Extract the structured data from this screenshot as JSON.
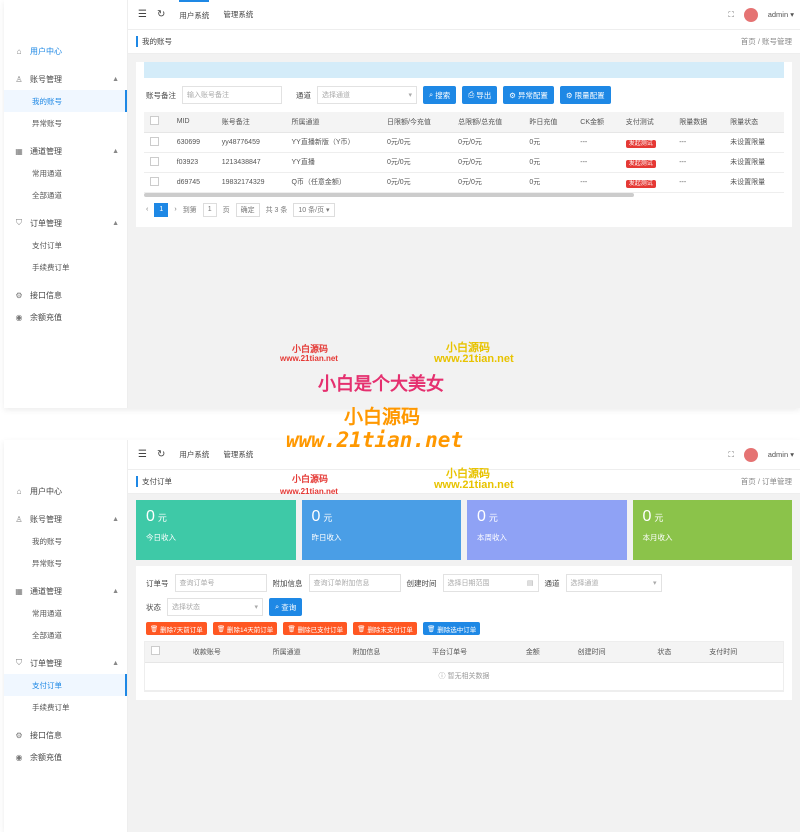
{
  "colors": {
    "accent": "#1e88e5",
    "stat1": "#3ec9a7",
    "stat2": "#4a9ee6",
    "stat3": "#8fa2f5",
    "stat4": "#8bc34a",
    "danger": "#ff5722"
  },
  "topbar": {
    "tabs": [
      "用户系统",
      "管理系统"
    ],
    "user": "admin"
  },
  "sidebar": {
    "home": "用户中心",
    "groups": [
      {
        "label": "账号管理",
        "items": [
          "我的账号",
          "异常账号"
        ]
      },
      {
        "label": "通道管理",
        "items": [
          "常用通道",
          "全部通道"
        ]
      },
      {
        "label": "订单管理",
        "items": [
          "支付订单",
          "手续费订单"
        ]
      }
    ],
    "api": "接口信息",
    "recharge": "余额充值"
  },
  "panel1": {
    "crumb_title": "我的账号",
    "crumb_path": "首页 / 账号管理",
    "filter": {
      "remark_label": "账号备注",
      "remark_placeholder": "输入账号备注",
      "channel_label": "通道",
      "channel_placeholder": "选择通道",
      "buttons": [
        "搜索",
        "导出",
        "异常配置",
        "限量配置"
      ]
    },
    "table": {
      "headers": [
        "MID",
        "账号备注",
        "所属通道",
        "日限额/今充值",
        "总限额/总充值",
        "昨日充值",
        "CK金额",
        "支付测试",
        "限量数据",
        "限量状态"
      ],
      "rows": [
        [
          "630699",
          "yy48776459",
          "YY直播新版（Y币）",
          "0元/0元",
          "0元/0元",
          "0元",
          "---",
          "发起测试",
          "---",
          "未设置限量"
        ],
        [
          "f03923",
          "1213438847",
          "YY直播",
          "0元/0元",
          "0元/0元",
          "0元",
          "---",
          "发起测试",
          "---",
          "未设置限量"
        ],
        [
          "d69745",
          "19832174329",
          "Q币（任意金额）",
          "0元/0元",
          "0元/0元",
          "0元",
          "---",
          "发起测试",
          "---",
          "未设置限量"
        ]
      ]
    },
    "pager": {
      "current": "1",
      "goto_prefix": "到第",
      "goto_page": "1",
      "goto_suffix": "页",
      "confirm": "确定",
      "total": "共 3 条",
      "per_page": "10 条/页"
    }
  },
  "panel2": {
    "crumb_title": "支付订单",
    "crumb_path": "首页 / 订单管理",
    "stats": [
      {
        "value": "0",
        "unit": "元",
        "caption": "今日收入"
      },
      {
        "value": "0",
        "unit": "元",
        "caption": "昨日收入"
      },
      {
        "value": "0",
        "unit": "元",
        "caption": "本周收入"
      },
      {
        "value": "0",
        "unit": "元",
        "caption": "本月收入"
      }
    ],
    "filter": {
      "order_label": "订单号",
      "order_placeholder": "查询订单号",
      "info_label": "附加信息",
      "info_placeholder": "查询订单附加信息",
      "time_label": "创建时间",
      "time_placeholder": "选择日期范围",
      "channel_label": "通道",
      "channel_placeholder": "选择通道",
      "status_label": "状态",
      "status_placeholder": "选择状态",
      "search": "查询"
    },
    "actions": [
      "删除7天前订单",
      "删除14天前订单",
      "删除已支付订单",
      "删除未支付订单",
      "删除选中订单"
    ],
    "table": {
      "headers": [
        "收款账号",
        "所属通道",
        "附加信息",
        "平台订单号",
        "金额",
        "创建时间",
        "状态",
        "支付时间"
      ],
      "empty": "暂无相关数据"
    }
  },
  "watermarks": {
    "a1": "小白源码",
    "a2": "www.21tian.net",
    "b1": "小白源码",
    "b2": "www.21tian.net",
    "big": "小白是个大美女",
    "c1": "小白源码",
    "c2": "www.21tian.net"
  }
}
